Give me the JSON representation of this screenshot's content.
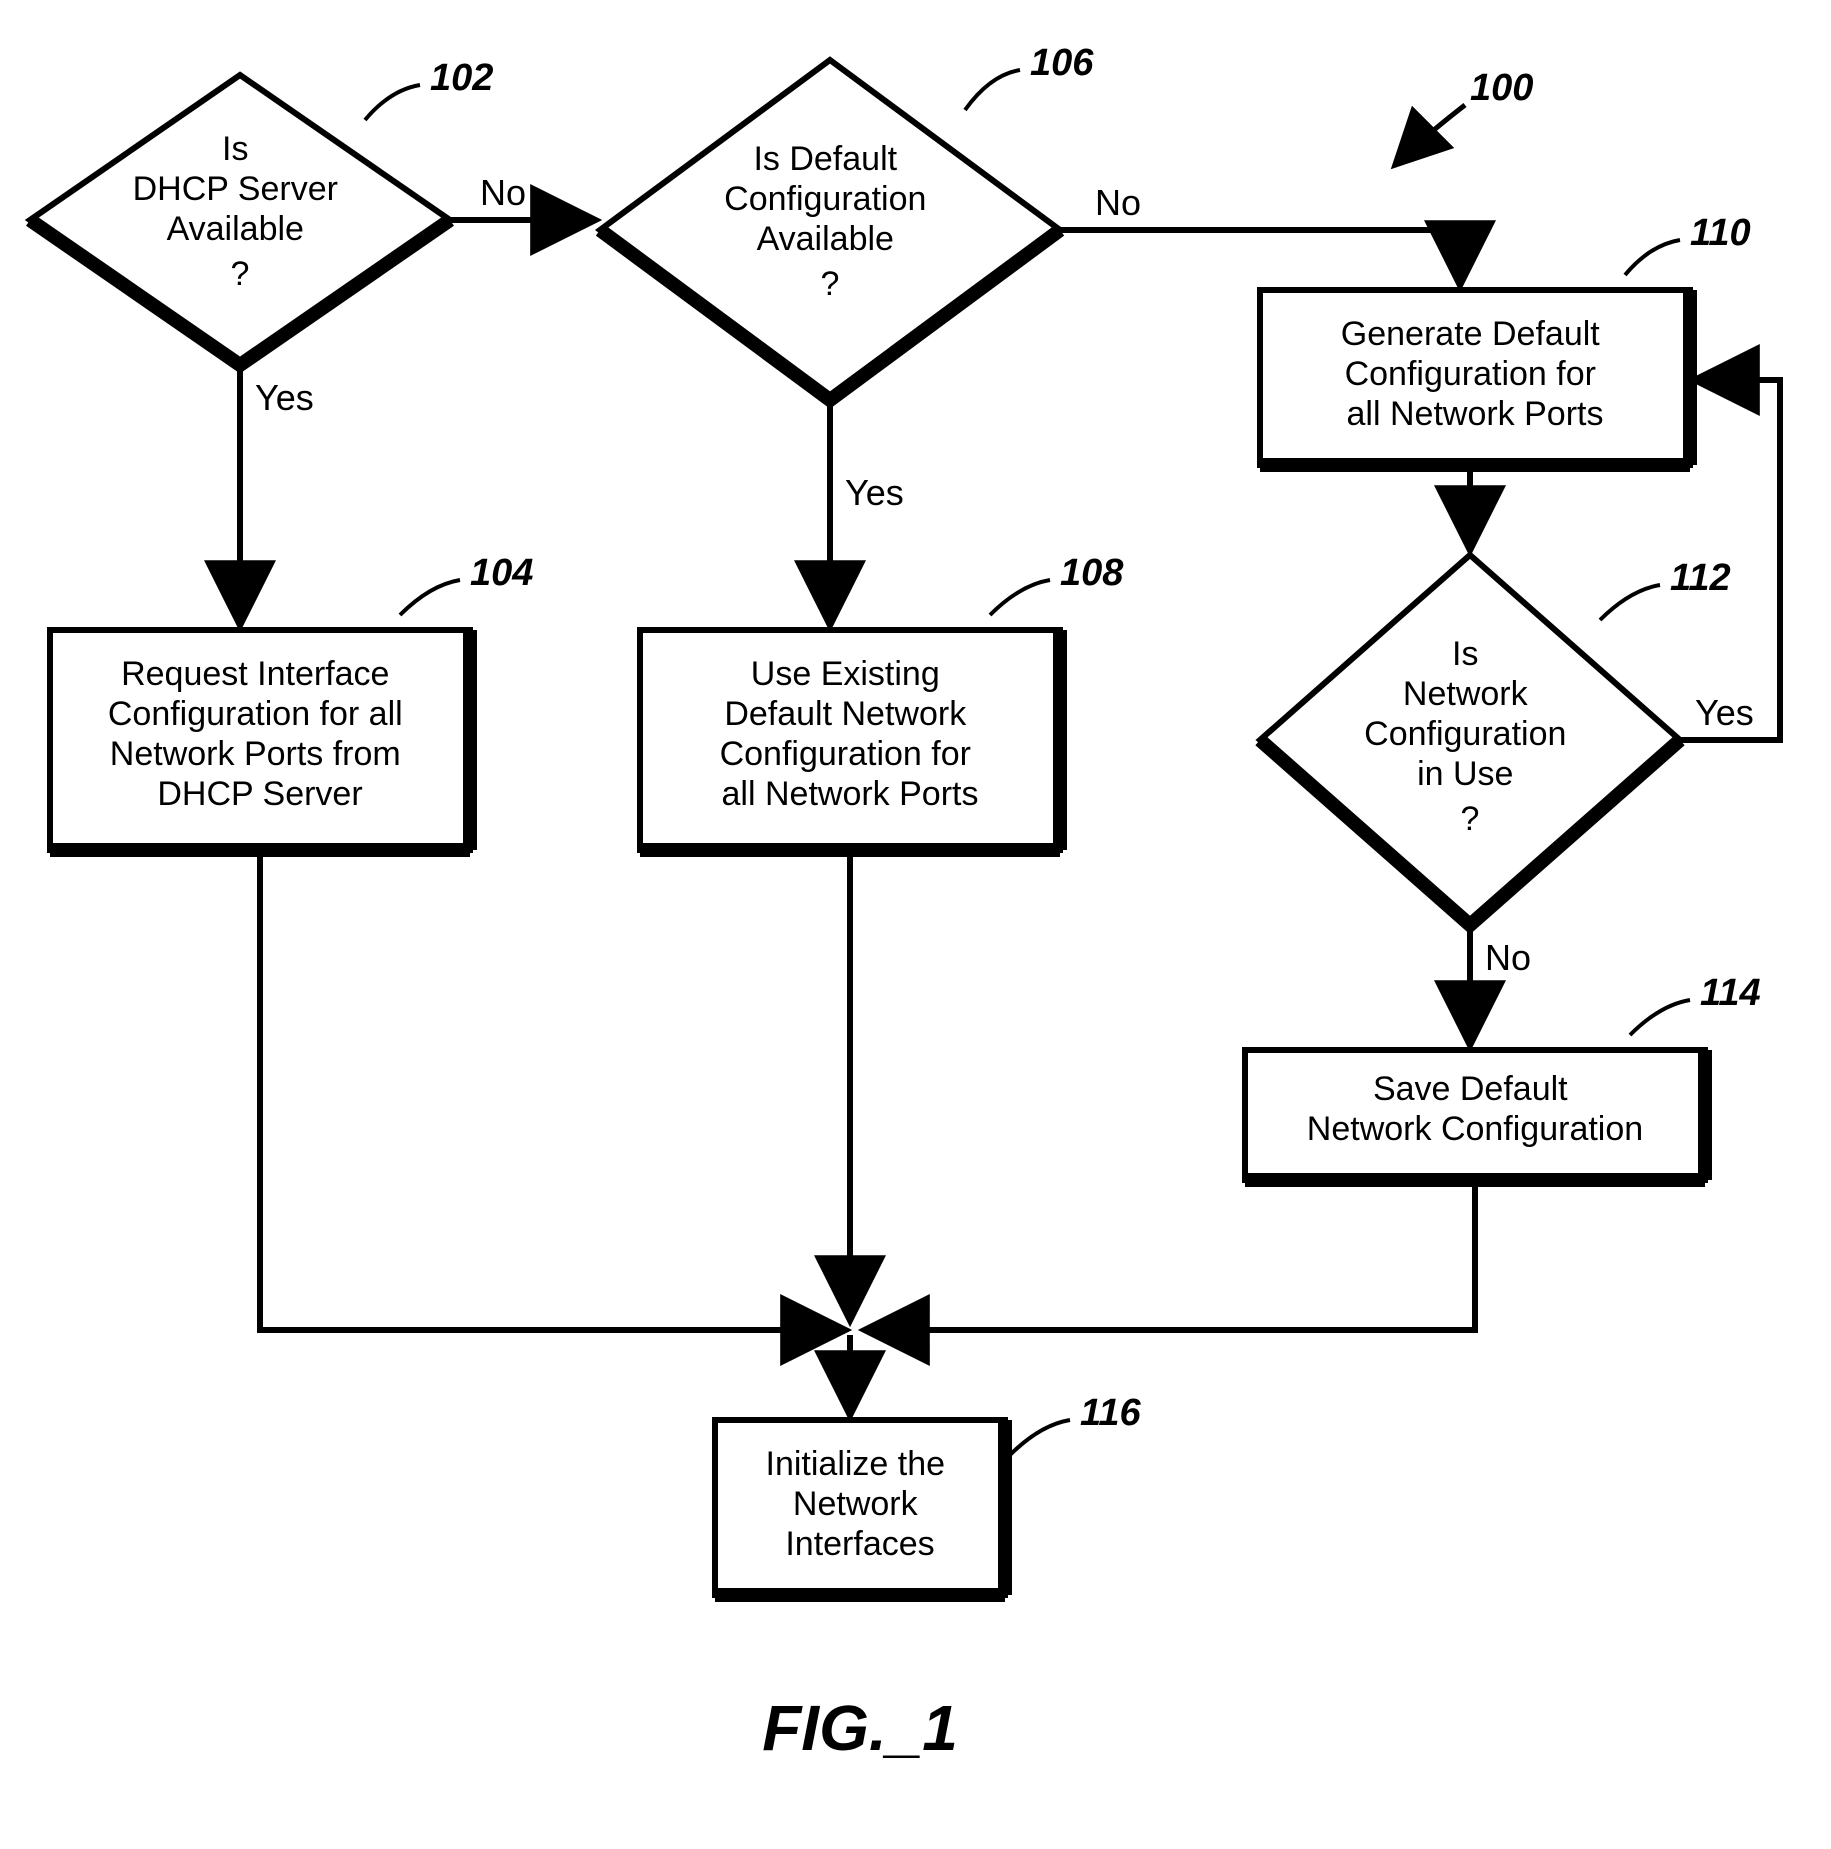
{
  "figure_label": "FIG._1",
  "ref": {
    "overall": "100",
    "d102": "102",
    "p104": "104",
    "d106": "106",
    "p108": "108",
    "p110": "110",
    "d112": "112",
    "p114": "114",
    "p116": "116"
  },
  "nodes": {
    "d102": [
      "Is",
      "DHCP Server",
      "Available",
      "?"
    ],
    "d106": [
      "Is Default",
      "Configuration",
      "Available",
      "?"
    ],
    "d112": [
      "Is",
      "Network",
      "Configuration",
      "in Use",
      "?"
    ],
    "p104": [
      "Request Interface",
      "Configuration for all",
      "Network Ports from",
      "DHCP Server"
    ],
    "p108": [
      "Use Existing",
      "Default Network",
      "Configuration for",
      "all Network Ports"
    ],
    "p110": [
      "Generate Default",
      "Configuration for",
      "all Network Ports"
    ],
    "p114": [
      "Save Default",
      "Network Configuration"
    ],
    "p116": [
      "Initialize the",
      "Network",
      "Interfaces"
    ]
  },
  "edges": {
    "yes": "Yes",
    "no": "No"
  }
}
